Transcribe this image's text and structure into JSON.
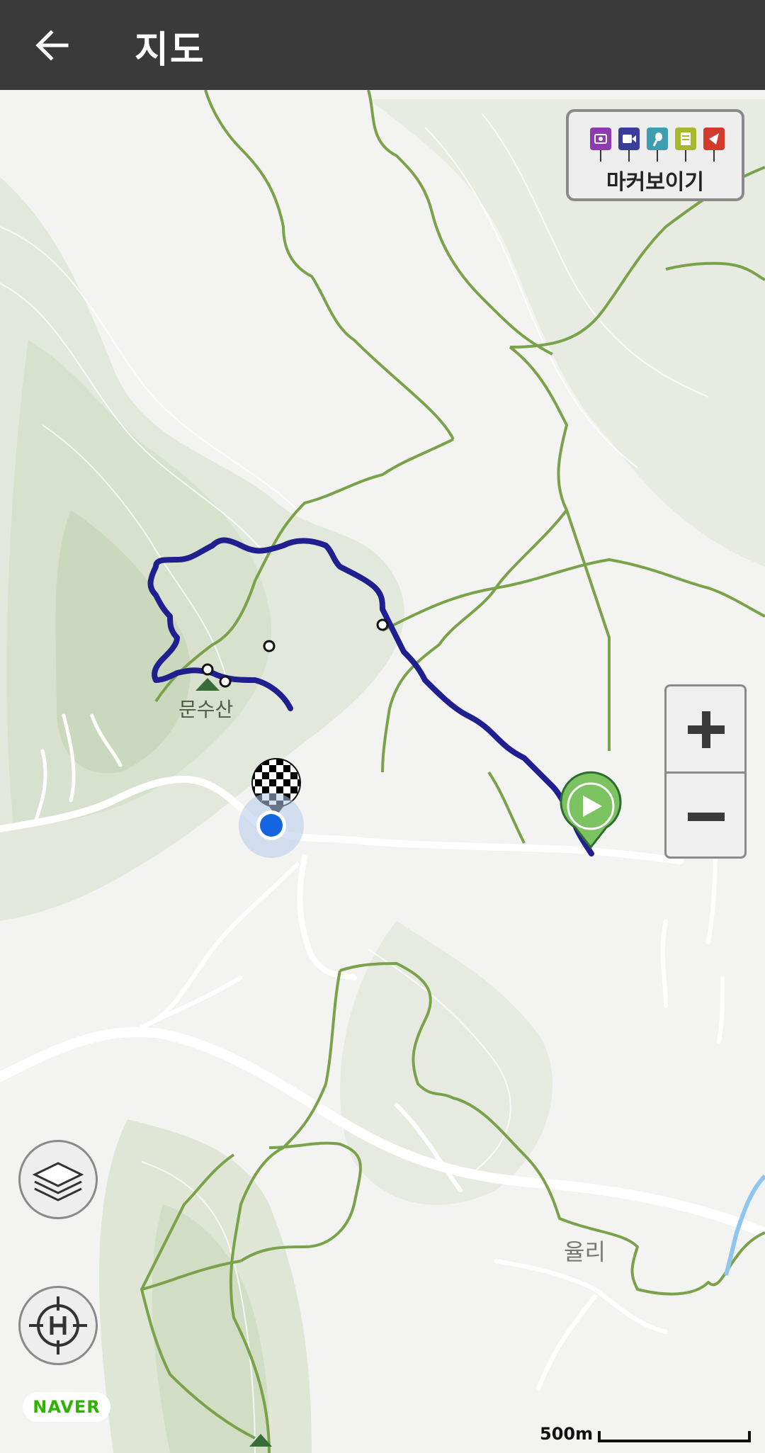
{
  "header": {
    "title": "지도"
  },
  "marker_view": {
    "label": "마커보이기",
    "pins": [
      {
        "name": "camera-pin-icon",
        "color": "#8e3bb0"
      },
      {
        "name": "video-pin-icon",
        "color": "#3b3d9a"
      },
      {
        "name": "audio-pin-icon",
        "color": "#3e9db0"
      },
      {
        "name": "memo-pin-icon",
        "color": "#a8b82e"
      },
      {
        "name": "flag-pin-icon",
        "color": "#d23a2e"
      }
    ]
  },
  "map": {
    "places": {
      "mountain": "문수산",
      "village": "율리"
    },
    "scale": "500m",
    "provider": "NAVER",
    "colors": {
      "track": "#1f1f8f",
      "trail": "#7aa24a",
      "road": "#ffffff",
      "current": "#1565e0"
    }
  },
  "zoom": {
    "in_symbol": "+",
    "out_symbol": "−"
  }
}
